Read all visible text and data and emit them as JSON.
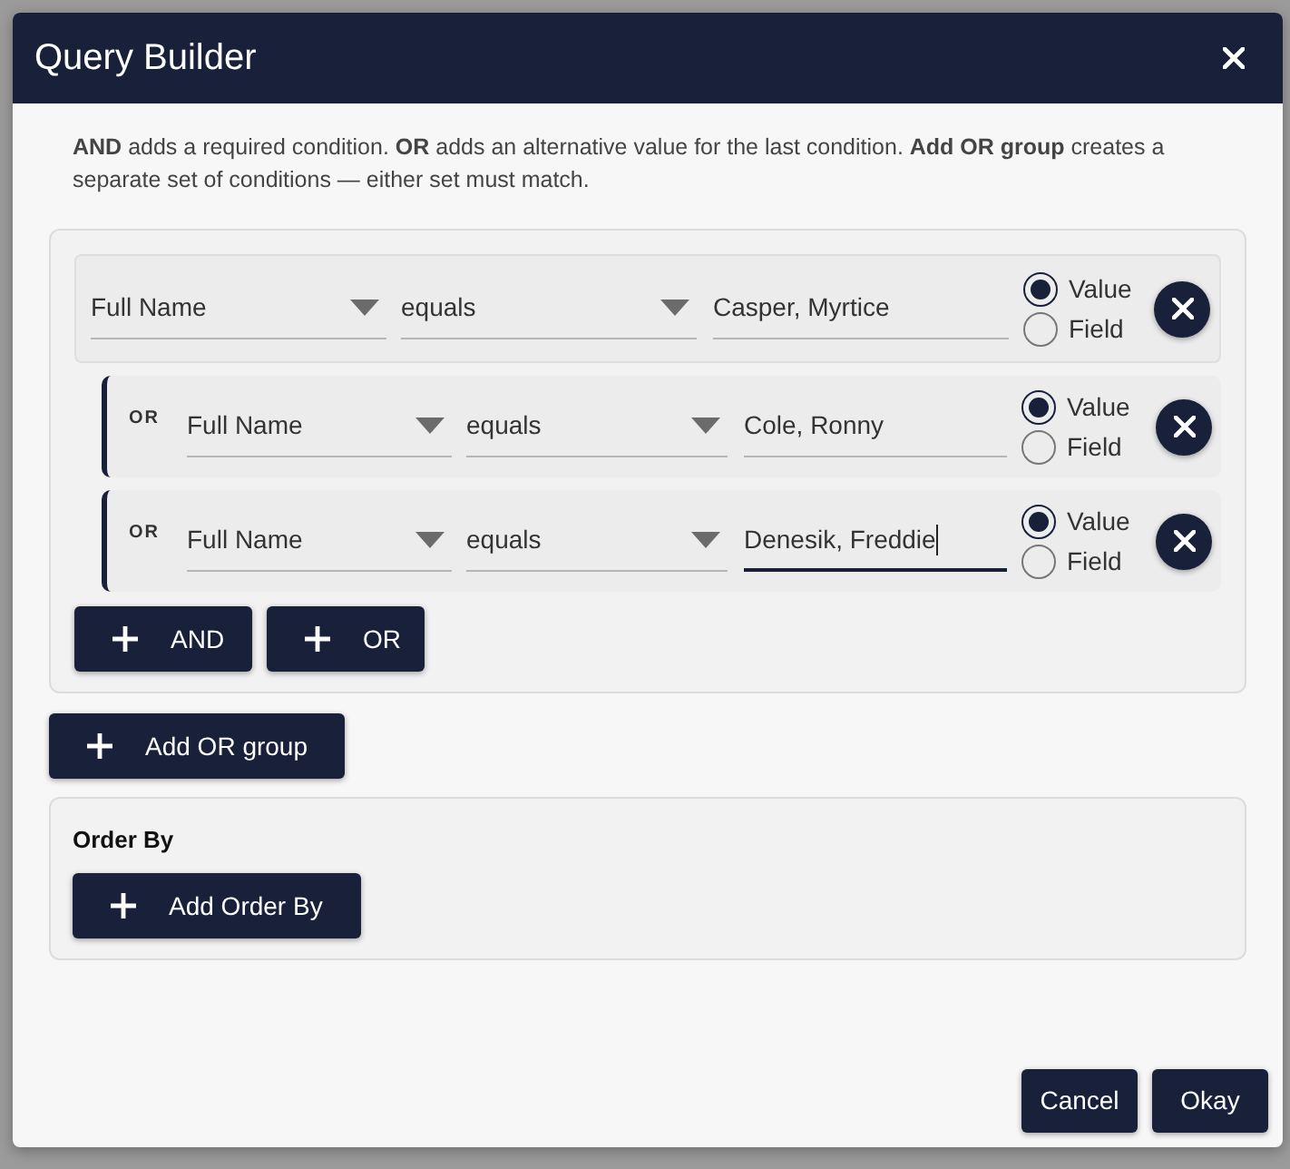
{
  "dialog": {
    "title": "Query Builder"
  },
  "description": "**AND** adds a required condition. **OR** adds an alternative value for the last condition. **Add OR group** creates a separate set of conditions — either set must match.",
  "conditions": [
    {
      "kind": "first",
      "field": "Full Name",
      "operator": "equals",
      "value": "Casper, Myrtice",
      "focused": false,
      "modes": [
        {
          "label": "Value",
          "selected": true
        },
        {
          "label": "Field",
          "selected": false
        }
      ]
    },
    {
      "kind": "or",
      "prefix": "OR",
      "field": "Full Name",
      "operator": "equals",
      "value": "Cole, Ronny",
      "focused": false,
      "modes": [
        {
          "label": "Value",
          "selected": true
        },
        {
          "label": "Field",
          "selected": false
        }
      ]
    },
    {
      "kind": "or",
      "prefix": "OR",
      "field": "Full Name",
      "operator": "equals",
      "value": "Denesik, Freddie",
      "focused": true,
      "modes": [
        {
          "label": "Value",
          "selected": true
        },
        {
          "label": "Field",
          "selected": false
        }
      ]
    }
  ],
  "group_buttons": [
    "AND",
    "OR"
  ],
  "add_group_button": "Add OR group",
  "order_by": {
    "title": "Order By",
    "button": "Add Order By"
  },
  "footer_buttons": [
    "Cancel",
    "Okay"
  ]
}
